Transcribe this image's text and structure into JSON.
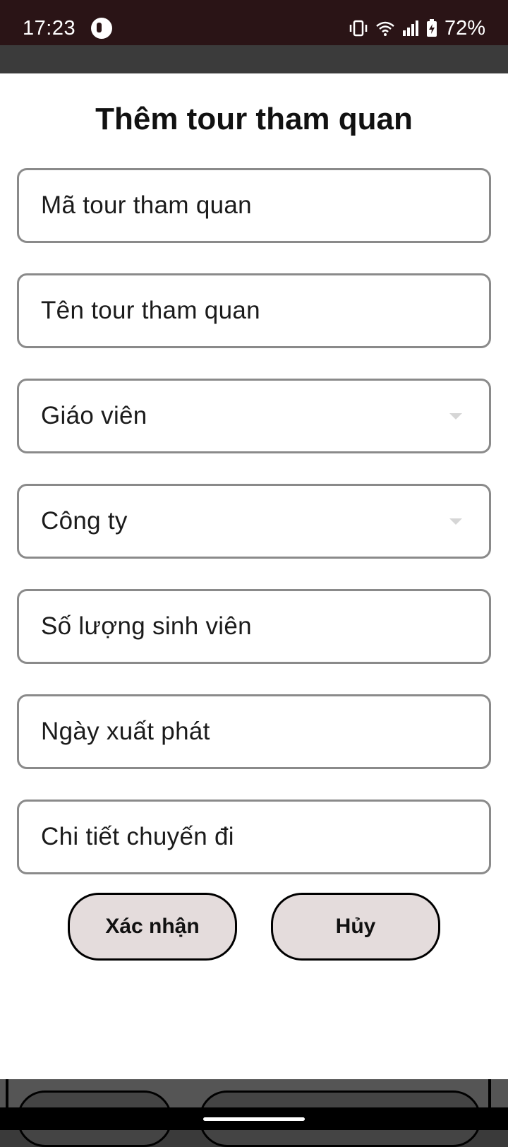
{
  "status_bar": {
    "time": "17:23",
    "battery": "72%",
    "icons": [
      "app-icon",
      "vibrate-icon",
      "wifi-icon",
      "signal-icon",
      "battery-charging-icon"
    ]
  },
  "dialog": {
    "title": "Thêm tour tham quan",
    "fields": {
      "tour_code": "Mã tour tham quan",
      "tour_name": "Tên tour tham quan",
      "teacher": "Giáo viên",
      "company": "Công ty",
      "student_count": "Số lượng sinh viên",
      "departure_date": "Ngày xuất phát",
      "trip_details": "Chi tiết chuyến đi"
    },
    "buttons": {
      "confirm": "Xác nhận",
      "cancel": "Hủy"
    }
  },
  "colors": {
    "status_bar": "#2a1416",
    "button_fill": "#e4dcdc",
    "field_border": "#8a8a8a"
  }
}
